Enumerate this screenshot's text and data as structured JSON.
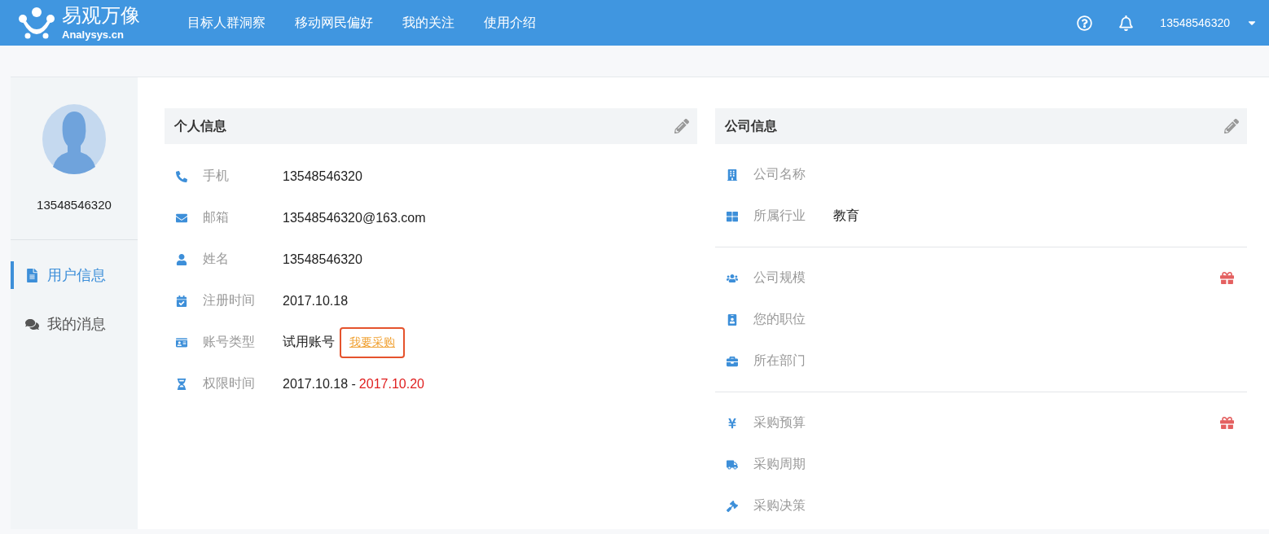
{
  "header": {
    "logo_title": "易观万像",
    "logo_subtitle": "Analysys.cn",
    "nav": [
      {
        "label": "目标人群洞察"
      },
      {
        "label": "移动网民偏好"
      },
      {
        "label": "我的关注"
      },
      {
        "label": "使用介绍"
      }
    ],
    "user": "13548546320"
  },
  "sidebar": {
    "username": "13548546320",
    "items": [
      {
        "label": "用户信息",
        "selected": true
      },
      {
        "label": "我的消息",
        "selected": false
      }
    ]
  },
  "personal": {
    "title": "个人信息",
    "rows": [
      {
        "label": "手机",
        "value": "13548546320"
      },
      {
        "label": "邮箱",
        "value": "13548546320@163.com"
      },
      {
        "label": "姓名",
        "value": "13548546320"
      },
      {
        "label": "注册时间",
        "value": "2017.10.18"
      },
      {
        "label": "账号类型",
        "value": "试用账号",
        "link": {
          "label": "我要采购",
          "highlighted": true
        }
      },
      {
        "label": "权限时间",
        "value": "2017.10.18 -",
        "end": "2017.10.20"
      }
    ]
  },
  "company": {
    "title": "公司信息",
    "groups": [
      {
        "gift": false,
        "rows": [
          {
            "label": "公司名称"
          },
          {
            "label": "所属行业",
            "value": "教育"
          }
        ]
      },
      {
        "gift": true,
        "rows": [
          {
            "label": "公司规模"
          },
          {
            "label": "您的职位"
          },
          {
            "label": "所在部门"
          }
        ]
      },
      {
        "gift": true,
        "rows": [
          {
            "label": "采购预算"
          },
          {
            "label": "采购周期"
          },
          {
            "label": "采购决策"
          }
        ]
      }
    ]
  }
}
